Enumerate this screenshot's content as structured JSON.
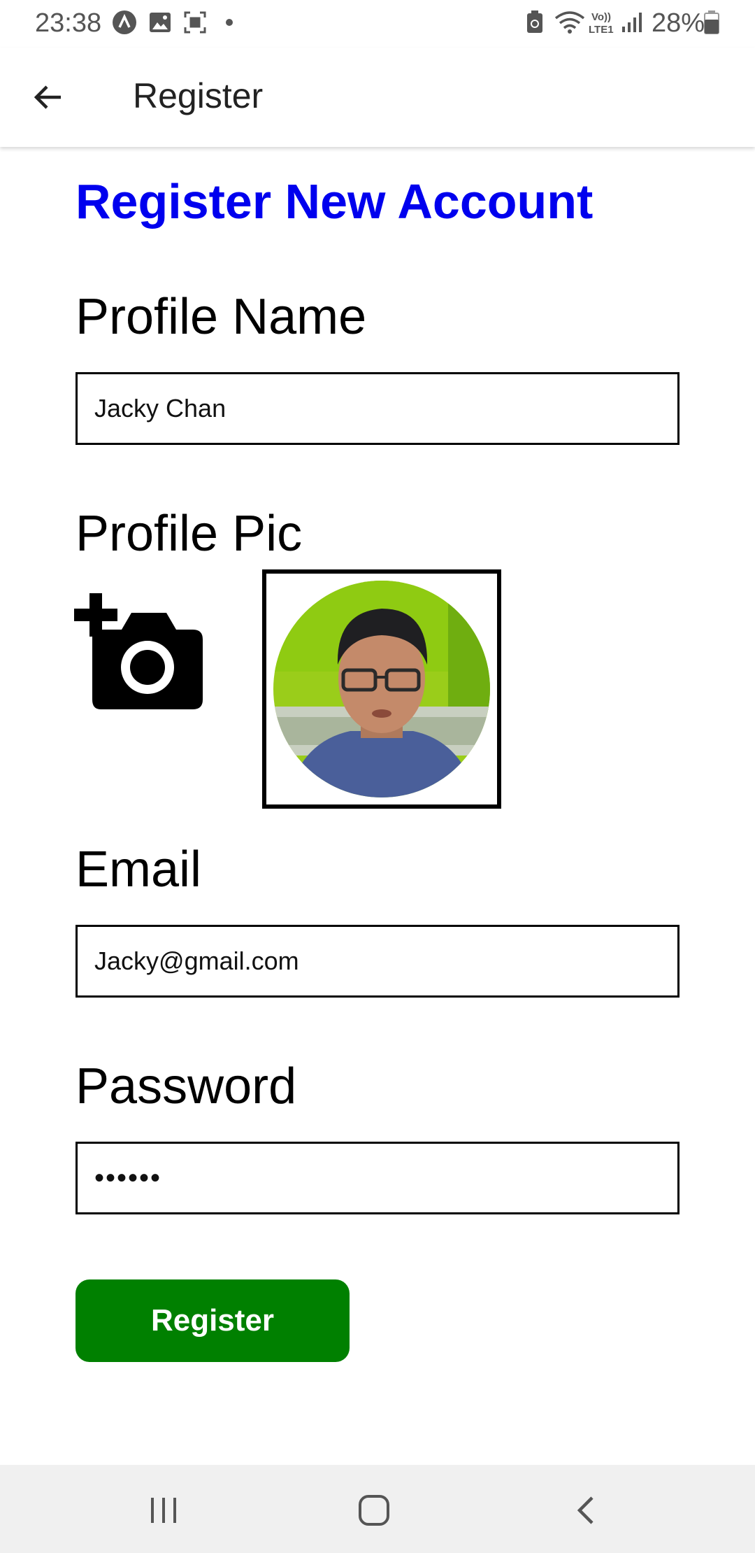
{
  "status_bar": {
    "time": "23:38",
    "battery_percent": "28%",
    "icons": [
      "assistant-icon",
      "image-icon",
      "screenshot-icon",
      "dot-icon",
      "battery-saver-icon",
      "wifi-icon",
      "volte-lte1-icon",
      "signal-icon",
      "battery-icon"
    ]
  },
  "app_bar": {
    "title": "Register",
    "back_icon": "arrow-left-icon"
  },
  "form": {
    "heading": "Register New Account",
    "profile_name_label": "Profile Name",
    "profile_name_value": "Jacky Chan",
    "profile_pic_label": "Profile Pic",
    "add_photo_icon": "add-a-photo-icon",
    "email_label": "Email",
    "email_value": "Jacky@gmail.com",
    "password_label": "Password",
    "password_value": "••••••",
    "register_button": "Register"
  },
  "nav_bar": {
    "icons": [
      "recent-apps-icon",
      "home-icon",
      "back-icon"
    ]
  },
  "colors": {
    "heading": "#0000ee",
    "register_button": "#008000",
    "nav_bar_bg": "#f0f0f0"
  }
}
